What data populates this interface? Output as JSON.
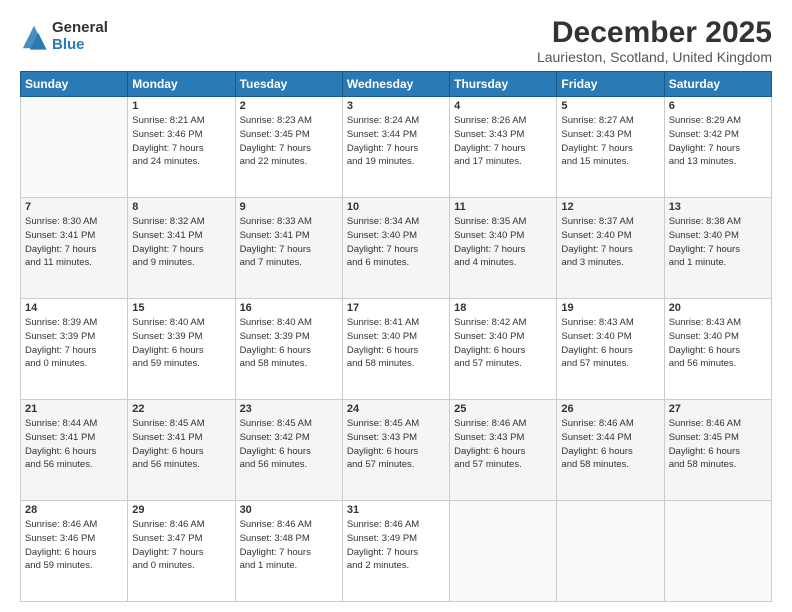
{
  "logo": {
    "general": "General",
    "blue": "Blue"
  },
  "title": "December 2025",
  "location": "Laurieston, Scotland, United Kingdom",
  "headers": [
    "Sunday",
    "Monday",
    "Tuesday",
    "Wednesday",
    "Thursday",
    "Friday",
    "Saturday"
  ],
  "weeks": [
    [
      {
        "day": "",
        "info": ""
      },
      {
        "day": "1",
        "info": "Sunrise: 8:21 AM\nSunset: 3:46 PM\nDaylight: 7 hours\nand 24 minutes."
      },
      {
        "day": "2",
        "info": "Sunrise: 8:23 AM\nSunset: 3:45 PM\nDaylight: 7 hours\nand 22 minutes."
      },
      {
        "day": "3",
        "info": "Sunrise: 8:24 AM\nSunset: 3:44 PM\nDaylight: 7 hours\nand 19 minutes."
      },
      {
        "day": "4",
        "info": "Sunrise: 8:26 AM\nSunset: 3:43 PM\nDaylight: 7 hours\nand 17 minutes."
      },
      {
        "day": "5",
        "info": "Sunrise: 8:27 AM\nSunset: 3:43 PM\nDaylight: 7 hours\nand 15 minutes."
      },
      {
        "day": "6",
        "info": "Sunrise: 8:29 AM\nSunset: 3:42 PM\nDaylight: 7 hours\nand 13 minutes."
      }
    ],
    [
      {
        "day": "7",
        "info": "Sunrise: 8:30 AM\nSunset: 3:41 PM\nDaylight: 7 hours\nand 11 minutes."
      },
      {
        "day": "8",
        "info": "Sunrise: 8:32 AM\nSunset: 3:41 PM\nDaylight: 7 hours\nand 9 minutes."
      },
      {
        "day": "9",
        "info": "Sunrise: 8:33 AM\nSunset: 3:41 PM\nDaylight: 7 hours\nand 7 minutes."
      },
      {
        "day": "10",
        "info": "Sunrise: 8:34 AM\nSunset: 3:40 PM\nDaylight: 7 hours\nand 6 minutes."
      },
      {
        "day": "11",
        "info": "Sunrise: 8:35 AM\nSunset: 3:40 PM\nDaylight: 7 hours\nand 4 minutes."
      },
      {
        "day": "12",
        "info": "Sunrise: 8:37 AM\nSunset: 3:40 PM\nDaylight: 7 hours\nand 3 minutes."
      },
      {
        "day": "13",
        "info": "Sunrise: 8:38 AM\nSunset: 3:40 PM\nDaylight: 7 hours\nand 1 minute."
      }
    ],
    [
      {
        "day": "14",
        "info": "Sunrise: 8:39 AM\nSunset: 3:39 PM\nDaylight: 7 hours\nand 0 minutes."
      },
      {
        "day": "15",
        "info": "Sunrise: 8:40 AM\nSunset: 3:39 PM\nDaylight: 6 hours\nand 59 minutes."
      },
      {
        "day": "16",
        "info": "Sunrise: 8:40 AM\nSunset: 3:39 PM\nDaylight: 6 hours\nand 58 minutes."
      },
      {
        "day": "17",
        "info": "Sunrise: 8:41 AM\nSunset: 3:40 PM\nDaylight: 6 hours\nand 58 minutes."
      },
      {
        "day": "18",
        "info": "Sunrise: 8:42 AM\nSunset: 3:40 PM\nDaylight: 6 hours\nand 57 minutes."
      },
      {
        "day": "19",
        "info": "Sunrise: 8:43 AM\nSunset: 3:40 PM\nDaylight: 6 hours\nand 57 minutes."
      },
      {
        "day": "20",
        "info": "Sunrise: 8:43 AM\nSunset: 3:40 PM\nDaylight: 6 hours\nand 56 minutes."
      }
    ],
    [
      {
        "day": "21",
        "info": "Sunrise: 8:44 AM\nSunset: 3:41 PM\nDaylight: 6 hours\nand 56 minutes."
      },
      {
        "day": "22",
        "info": "Sunrise: 8:45 AM\nSunset: 3:41 PM\nDaylight: 6 hours\nand 56 minutes."
      },
      {
        "day": "23",
        "info": "Sunrise: 8:45 AM\nSunset: 3:42 PM\nDaylight: 6 hours\nand 56 minutes."
      },
      {
        "day": "24",
        "info": "Sunrise: 8:45 AM\nSunset: 3:43 PM\nDaylight: 6 hours\nand 57 minutes."
      },
      {
        "day": "25",
        "info": "Sunrise: 8:46 AM\nSunset: 3:43 PM\nDaylight: 6 hours\nand 57 minutes."
      },
      {
        "day": "26",
        "info": "Sunrise: 8:46 AM\nSunset: 3:44 PM\nDaylight: 6 hours\nand 58 minutes."
      },
      {
        "day": "27",
        "info": "Sunrise: 8:46 AM\nSunset: 3:45 PM\nDaylight: 6 hours\nand 58 minutes."
      }
    ],
    [
      {
        "day": "28",
        "info": "Sunrise: 8:46 AM\nSunset: 3:46 PM\nDaylight: 6 hours\nand 59 minutes."
      },
      {
        "day": "29",
        "info": "Sunrise: 8:46 AM\nSunset: 3:47 PM\nDaylight: 7 hours\nand 0 minutes."
      },
      {
        "day": "30",
        "info": "Sunrise: 8:46 AM\nSunset: 3:48 PM\nDaylight: 7 hours\nand 1 minute."
      },
      {
        "day": "31",
        "info": "Sunrise: 8:46 AM\nSunset: 3:49 PM\nDaylight: 7 hours\nand 2 minutes."
      },
      {
        "day": "",
        "info": ""
      },
      {
        "day": "",
        "info": ""
      },
      {
        "day": "",
        "info": ""
      }
    ]
  ]
}
